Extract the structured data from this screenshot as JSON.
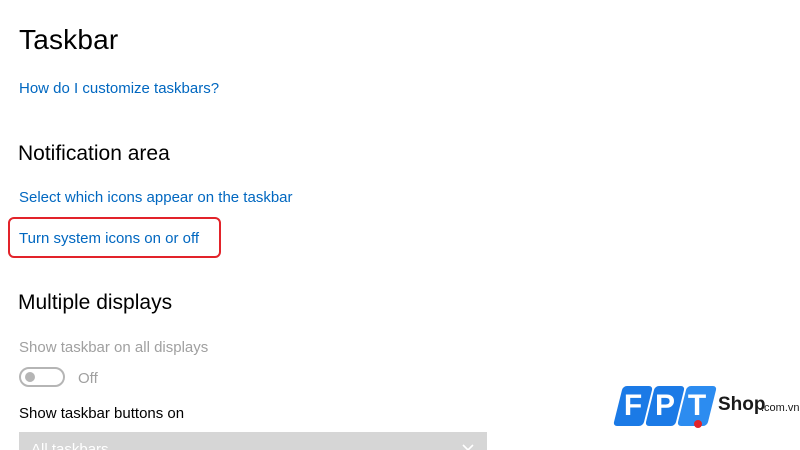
{
  "header": {
    "title": "Taskbar",
    "help_link": "How do I customize taskbars?"
  },
  "notification_area": {
    "title": "Notification area",
    "links": [
      "Select which icons appear on the taskbar",
      "Turn system icons on or off"
    ],
    "highlight_color": "#e2232a"
  },
  "multiple_displays": {
    "title": "Multiple displays",
    "show_on_all_label": "Show taskbar on all displays",
    "toggle_state": "Off",
    "buttons_on_label": "Show taskbar buttons on",
    "buttons_on_value": "All taskbars"
  },
  "watermark": {
    "letters": [
      "F",
      "P",
      "T"
    ],
    "shop": "Shop",
    "domain": ".com.vn",
    "brand_color": "#1b7ae6"
  },
  "colors": {
    "link": "#0067c0",
    "disabled": "#a0a0a0",
    "accent_red": "#e2232a"
  }
}
